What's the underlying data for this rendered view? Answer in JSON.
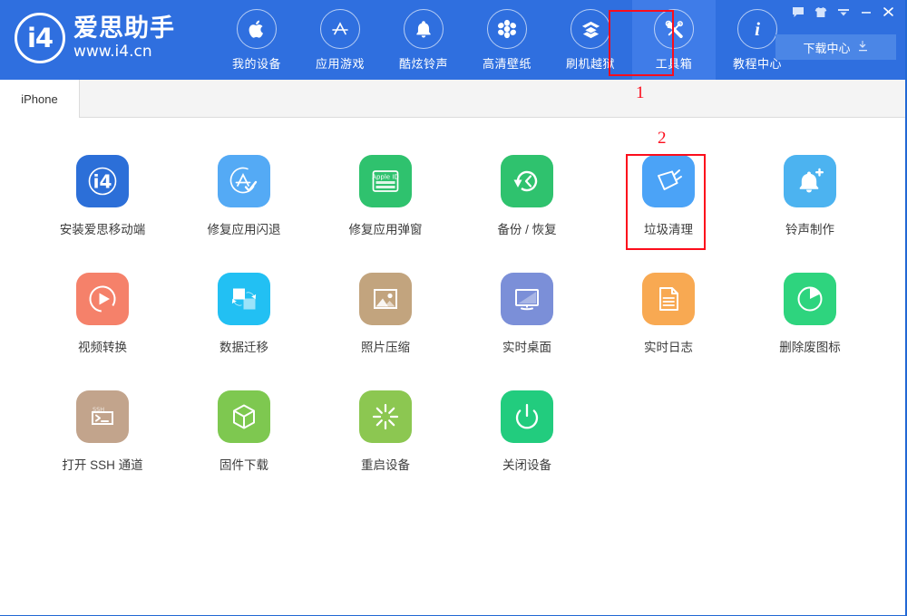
{
  "window": {
    "controls": [
      {
        "name": "feedback-icon",
        "glyph": "speech-bubble"
      },
      {
        "name": "skin-icon",
        "glyph": "t-shirt"
      },
      {
        "name": "menu-icon",
        "glyph": "chevron-down-bar"
      },
      {
        "name": "minimize-icon",
        "glyph": "minus"
      },
      {
        "name": "close-icon",
        "glyph": "x"
      }
    ],
    "download_center_label": "下载中心"
  },
  "brand": {
    "mark": "i4",
    "name": "爱思助手",
    "url": "www.i4.cn"
  },
  "nav": {
    "items": [
      {
        "label": "我的设备",
        "icon": "apple-icon",
        "active": false
      },
      {
        "label": "应用游戏",
        "icon": "appstore-icon",
        "active": false
      },
      {
        "label": "酷炫铃声",
        "icon": "bell-icon",
        "active": false
      },
      {
        "label": "高清壁纸",
        "icon": "flower-icon",
        "active": false
      },
      {
        "label": "刷机越狱",
        "icon": "box-open-icon",
        "active": false
      },
      {
        "label": "工具箱",
        "icon": "tools-icon",
        "active": true
      },
      {
        "label": "教程中心",
        "icon": "info-icon",
        "active": false
      }
    ]
  },
  "tabs": [
    {
      "label": "iPhone",
      "active": true
    }
  ],
  "tools": [
    {
      "label": "安装爱思移动端",
      "icon": "i4-app-icon",
      "bg": "#2c6fd8",
      "fg": "#ffffff"
    },
    {
      "label": "修复应用闪退",
      "icon": "appstore-check-icon",
      "bg": "#54aaf5",
      "fg": "#ffffff"
    },
    {
      "label": "修复应用弹窗",
      "icon": "apple-id-card-icon",
      "bg": "#2fc26e",
      "fg": "#ffffff"
    },
    {
      "label": "备份 / 恢复",
      "icon": "restore-arrow-icon",
      "bg": "#2fc26e",
      "fg": "#ffffff"
    },
    {
      "label": "垃圾清理",
      "icon": "broom-icon",
      "bg": "#4ba3f7",
      "fg": "#ffffff"
    },
    {
      "label": "铃声制作",
      "icon": "bell-plus-icon",
      "bg": "#4cb3f0",
      "fg": "#ffffff"
    },
    {
      "label": "视频转换",
      "icon": "play-circle-icon",
      "bg": "#f5816a",
      "fg": "#ffffff"
    },
    {
      "label": "数据迁移",
      "icon": "migrate-icon",
      "bg": "#22c0f3",
      "fg": "#ffffff"
    },
    {
      "label": "照片压缩",
      "icon": "photo-icon",
      "bg": "#c2a47e",
      "fg": "#ffffff"
    },
    {
      "label": "实时桌面",
      "icon": "monitor-icon",
      "bg": "#7b8fd8",
      "fg": "#ffffff"
    },
    {
      "label": "实时日志",
      "icon": "document-icon",
      "bg": "#f8a952",
      "fg": "#ffffff"
    },
    {
      "label": "删除废图标",
      "icon": "pie-icon",
      "bg": "#2ed47e",
      "fg": "#ffffff"
    },
    {
      "label": "打开 SSH 通道",
      "icon": "ssh-terminal-icon",
      "bg": "#c2a48c",
      "fg": "#ffffff"
    },
    {
      "label": "固件下载",
      "icon": "cube-icon",
      "bg": "#7ec850",
      "fg": "#ffffff"
    },
    {
      "label": "重启设备",
      "icon": "restart-rays-icon",
      "bg": "#8cc751",
      "fg": "#ffffff"
    },
    {
      "label": "关闭设备",
      "icon": "power-icon",
      "bg": "#22cc7e",
      "fg": "#ffffff"
    }
  ],
  "annotations": [
    {
      "number": "1",
      "target": "工具箱"
    },
    {
      "number": "2",
      "target": "垃圾清理"
    }
  ],
  "colors": {
    "header_blue": "#2f6fdf",
    "active_nav_blue": "#3f7ce8",
    "annotation_red": "#fc0d1c",
    "tab_strip_gray": "#f4f4f4"
  }
}
